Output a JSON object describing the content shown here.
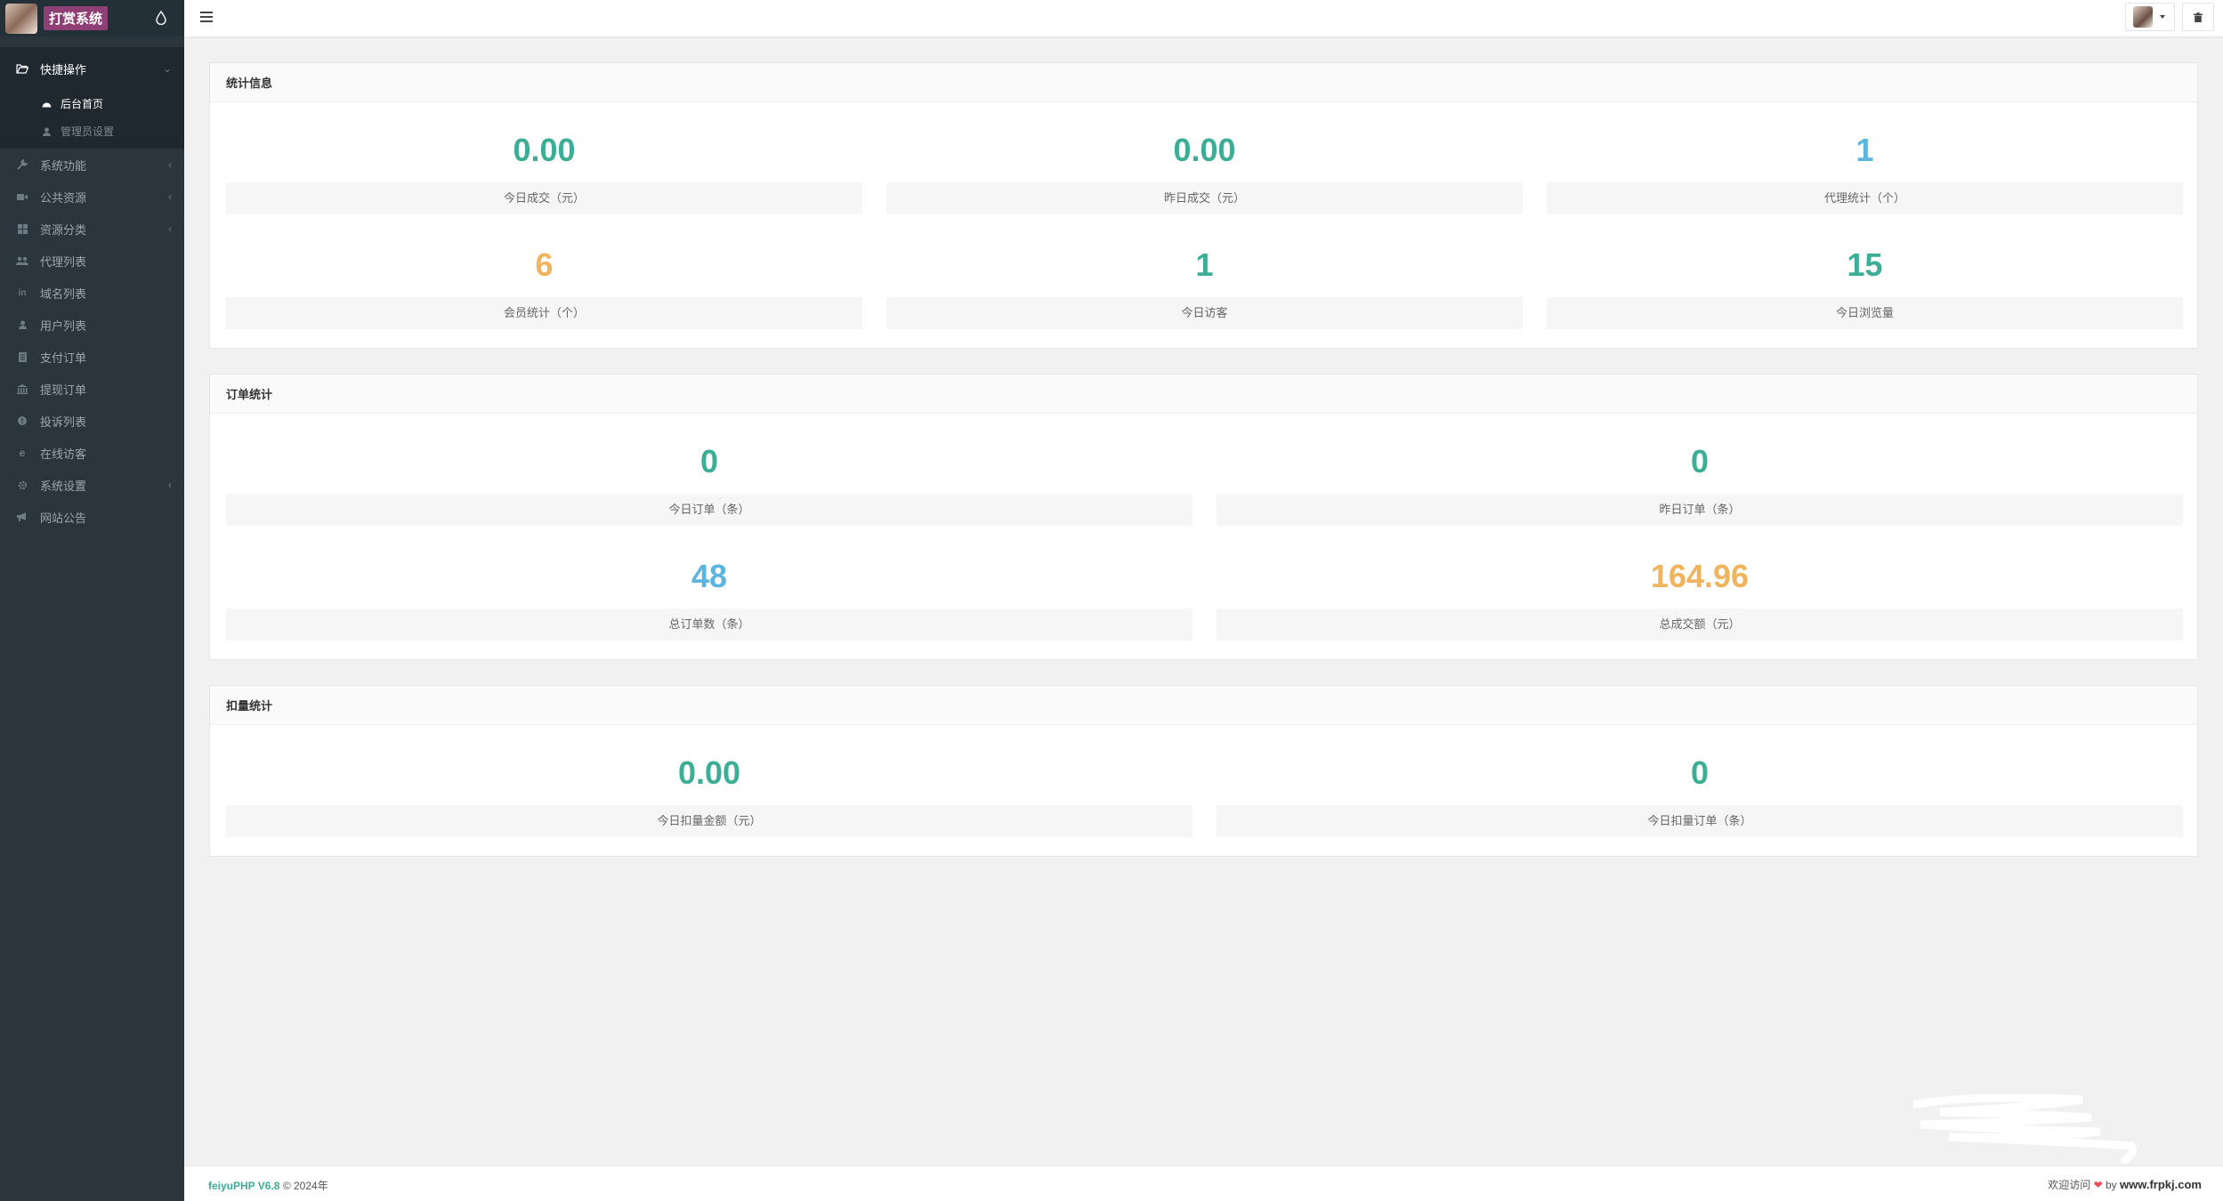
{
  "sidebar": {
    "brand": "打赏系统",
    "items": [
      {
        "label": "快捷操作",
        "icon": "folder-open-icon",
        "active": true
      },
      {
        "label": "系统功能",
        "icon": "wrench-icon"
      },
      {
        "label": "公共资源",
        "icon": "video-icon"
      },
      {
        "label": "资源分类",
        "icon": "grid-icon"
      },
      {
        "label": "代理列表",
        "icon": "users-icon"
      },
      {
        "label": "域名列表",
        "icon": "linkedin-icon"
      },
      {
        "label": "用户列表",
        "icon": "user-icon"
      },
      {
        "label": "支付订单",
        "icon": "document-icon"
      },
      {
        "label": "提现订单",
        "icon": "bank-icon"
      },
      {
        "label": "投诉列表",
        "icon": "alert-icon"
      },
      {
        "label": "在线访客",
        "icon": "ie-icon"
      },
      {
        "label": "系统设置",
        "icon": "gear-icon"
      },
      {
        "label": "网站公告",
        "icon": "megaphone-icon"
      }
    ],
    "sub_items": [
      {
        "label": "后台首页",
        "icon": "dashboard-icon",
        "active": true
      },
      {
        "label": "管理员设置",
        "icon": "user-icon"
      }
    ]
  },
  "panels": {
    "stats": {
      "title": "统计信息",
      "cards": [
        {
          "value": "0.00",
          "label": "今日成交（元）",
          "color": "#3cae96"
        },
        {
          "value": "0.00",
          "label": "昨日成交（元）",
          "color": "#3cae96"
        },
        {
          "value": "1",
          "label": "代理统计（个）",
          "color": "#5db4dc"
        },
        {
          "value": "6",
          "label": "会员统计（个）",
          "color": "#f0b45c"
        },
        {
          "value": "1",
          "label": "今日访客",
          "color": "#3cae96"
        },
        {
          "value": "15",
          "label": "今日浏览量",
          "color": "#3cae96"
        }
      ]
    },
    "orders": {
      "title": "订单统计",
      "cards": [
        {
          "value": "0",
          "label": "今日订单（条）",
          "color": "#3cae96"
        },
        {
          "value": "0",
          "label": "昨日订单（条）",
          "color": "#3cae96"
        },
        {
          "value": "48",
          "label": "总订单数（条）",
          "color": "#5db4dc"
        },
        {
          "value": "164.96",
          "label": "总成交额（元）",
          "color": "#f0b45c"
        }
      ]
    },
    "deduct": {
      "title": "扣量统计",
      "cards": [
        {
          "value": "0.00",
          "label": "今日扣量金额（元）",
          "color": "#3cae96"
        },
        {
          "value": "0",
          "label": "今日扣量订单（条）",
          "color": "#3cae96"
        }
      ]
    }
  },
  "footer": {
    "version": "feiyuPHP V6.8",
    "copyright": "© 2024年",
    "welcome": "欢迎访问",
    "by": "by",
    "site": "www.frpkj.com"
  }
}
